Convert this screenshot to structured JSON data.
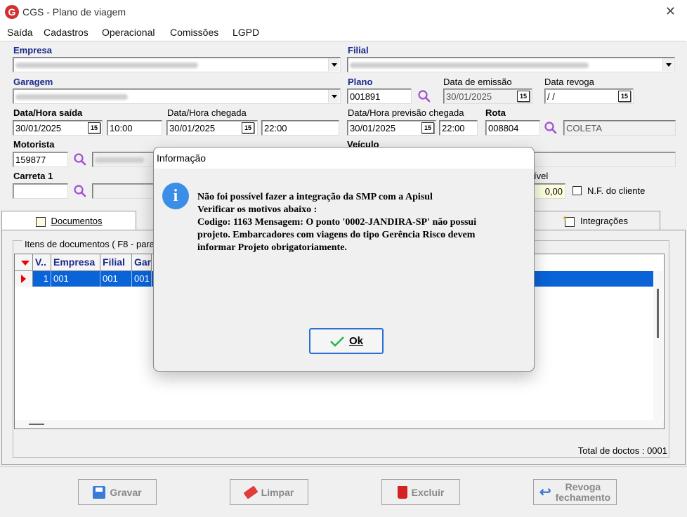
{
  "window": {
    "app_icon": "G",
    "title": "CGS - Plano de viagem",
    "close": "✕"
  },
  "menu": [
    "Saída",
    "Cadastros",
    "Operacional",
    "Comissões",
    "LGPD"
  ],
  "form": {
    "empresa_label": "Empresa",
    "filial_label": "Filial",
    "garagem_label": "Garagem",
    "plano_label": "Plano",
    "plano_value": "001891",
    "data_emissao_label": "Data de emissão",
    "data_emissao_value": "30/01/2025",
    "data_revoga_label": "Data revoga",
    "data_revoga_value": " / /",
    "data_saida_label": "Data/Hora saída",
    "data_saida_value": "30/01/2025",
    "hora_saida_value": "10:00",
    "data_chegada_label": "Data/Hora chegada",
    "data_chegada_value": "30/01/2025",
    "hora_chegada_value": "22:00",
    "data_prev_label": "Data/Hora previsão chegada",
    "data_prev_value": "30/01/2025",
    "hora_prev_value": "22:00",
    "rota_label": "Rota",
    "rota_value": "008804",
    "rota_desc": "COLETA",
    "motorista_label": "Motorista",
    "motorista_value": "159877",
    "veiculo_label": "Veículo",
    "carreta_label": "Carreta 1",
    "partial_label": "ível",
    "valor_value": "0,00",
    "nf_cliente_label": "N.F. do cliente",
    "cal_glyph": "15"
  },
  "tabs": {
    "documentos": "Documentos",
    "integracoes": "Integrações"
  },
  "grid": {
    "group_label": "Itens de documentos ( F8 - para",
    "headers": [
      "V..",
      "Empresa",
      "Filial",
      "Gar"
    ],
    "row": [
      "1",
      "001",
      "001",
      "001"
    ],
    "total": "Total de doctos : 0001"
  },
  "buttons": {
    "gravar": "Gravar",
    "limpar": "Limpar",
    "excluir": "Excluir",
    "revoga1": "Revoga",
    "revoga2": "fechamento"
  },
  "dialog": {
    "title": "Informação",
    "icon": "i",
    "lines": [
      "Não foi possível fazer a integração da SMP com a Apisul",
      "Verificar os motivos abaixo :",
      "Codigo: 1163 Mensagem: O ponto '0002-JANDIRA-SP' não possui",
      "projeto. Embarcadores com viagens do tipo Gerência Risco devem",
      "informar Projeto obrigatoriamente."
    ],
    "ok": "Ok"
  },
  "colors": {
    "label_blue": "#1a2a8c",
    "selection": "#0a64d8",
    "ok_border": "#2a6fd6"
  }
}
